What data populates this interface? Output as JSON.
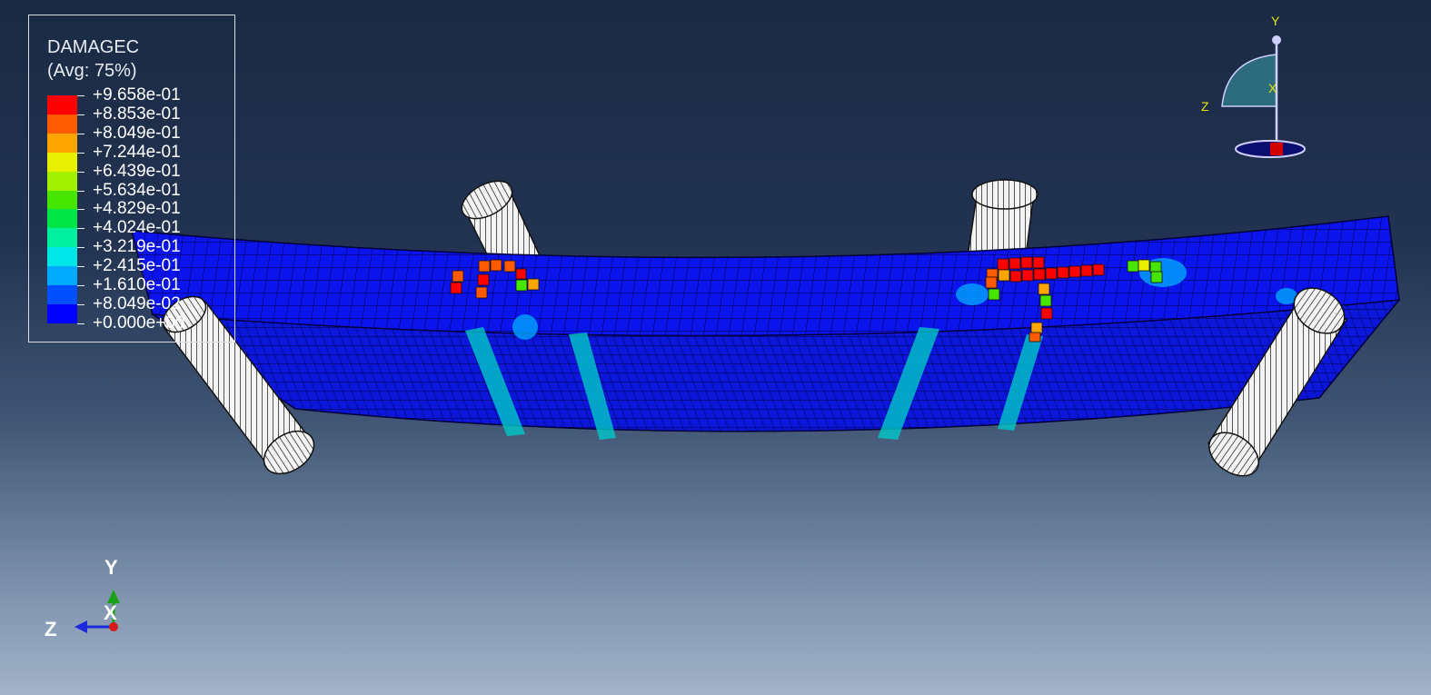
{
  "legend": {
    "title": "DAMAGEC",
    "subtitle": "(Avg: 75%)",
    "entries": [
      {
        "label": "+9.658e-01",
        "color": "#ff0000"
      },
      {
        "label": "+8.853e-01",
        "color": "#ff5a00"
      },
      {
        "label": "+8.049e-01",
        "color": "#ffa500"
      },
      {
        "label": "+7.244e-01",
        "color": "#e6f000"
      },
      {
        "label": "+6.439e-01",
        "color": "#a0f000"
      },
      {
        "label": "+5.634e-01",
        "color": "#46e600"
      },
      {
        "label": "+4.829e-01",
        "color": "#00e646"
      },
      {
        "label": "+4.024e-01",
        "color": "#00f0a0"
      },
      {
        "label": "+3.219e-01",
        "color": "#00e6e6"
      },
      {
        "label": "+2.415e-01",
        "color": "#00aaff"
      },
      {
        "label": "+1.610e-01",
        "color": "#0050ff"
      },
      {
        "label": "+8.049e-02",
        "color": "#0000ff"
      },
      {
        "label": "+0.000e+00",
        "color": null
      }
    ]
  },
  "orientation_triad": {
    "x": "X",
    "y": "Y",
    "z": "Z"
  },
  "view_cube": {
    "x": "X",
    "y": "Y",
    "z": "Z"
  },
  "colors": {
    "mesh_base": "#0a14e6",
    "mesh_lines": "#00003c",
    "roller": "#f2f2f2"
  }
}
